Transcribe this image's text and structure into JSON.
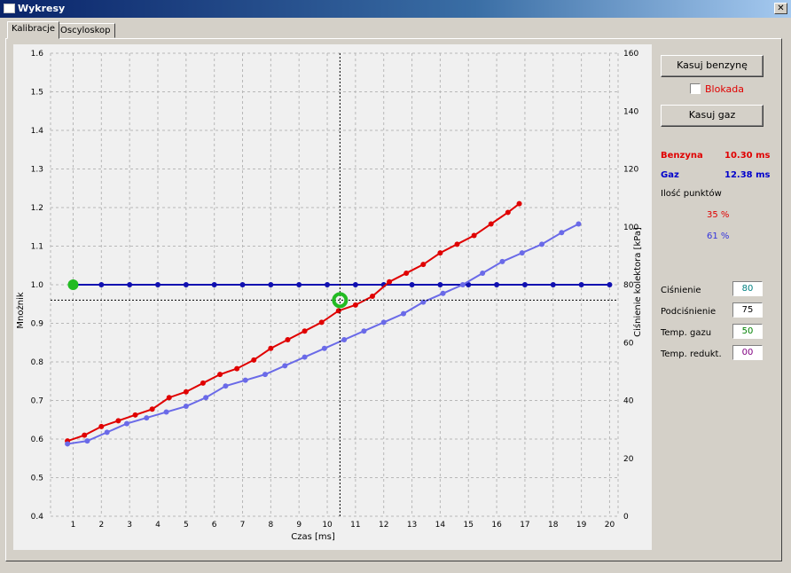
{
  "window": {
    "title": "Wykresy",
    "close_glyph": "✕"
  },
  "tabs": [
    {
      "label": "Kalibracje",
      "active": true
    },
    {
      "label": "Oscyloskop",
      "active": false
    }
  ],
  "side": {
    "kasuj_benzyne": "Kasuj benzynę",
    "blokada": "Blokada",
    "blokada_checked": false,
    "kasuj_gaz": "Kasuj gaz",
    "benzyna_label": "Benzyna",
    "benzyna_value": "10.30 ms",
    "gaz_label": "Gaz",
    "gaz_value": "12.38 ms",
    "ilosc_punktow": "Ilość punktów",
    "pct_benzyna": "35 %",
    "pct_gaz": "61 %",
    "fields": [
      {
        "label": "Ciśnienie",
        "value": "80",
        "color": "#008080"
      },
      {
        "label": "Podciśnienie",
        "value": "75",
        "color": "#000000"
      },
      {
        "label": "Temp. gazu",
        "value": "50",
        "color": "#008000"
      },
      {
        "label": "Temp. redukt.",
        "value": "00",
        "color": "#800080"
      }
    ]
  },
  "colors": {
    "benzyna": "#e00000",
    "gaz": "#0000cc",
    "blue_series": "#6a6ae8",
    "marker": "#22bb22"
  },
  "chart_data": {
    "type": "line",
    "xlabel": "Czas [ms]",
    "ylabel_left": "Mnożnik",
    "ylabel_right": "Ciśnienie kolektora [kPa]",
    "x_ticks": [
      1,
      2,
      3,
      4,
      5,
      6,
      7,
      8,
      9,
      10,
      11,
      12,
      13,
      14,
      15,
      16,
      17,
      18,
      19,
      20
    ],
    "y_left_ticks": [
      "0.4",
      "0.5",
      "0.6",
      "0.7",
      "0.8",
      "0.9",
      "1.0",
      "1.1",
      "1.2",
      "1.3",
      "1.4",
      "1.5",
      "1.6"
    ],
    "y_right_ticks": [
      "0",
      "20",
      "40",
      "60",
      "80",
      "100",
      "120",
      "140",
      "160"
    ],
    "ylim_left": [
      0.4,
      1.6
    ],
    "ylim_right": [
      0,
      160
    ],
    "xlim": [
      0.2,
      20.3
    ],
    "grid": true,
    "cursor": {
      "x": 10.45,
      "y_left": 0.96
    },
    "series": [
      {
        "color": "#1010b0",
        "axis": "left",
        "marker_start": "#22bb22",
        "points": [
          [
            1,
            1.0
          ],
          [
            2,
            1.0
          ],
          [
            3,
            1.0
          ],
          [
            4,
            1.0
          ],
          [
            5,
            1.0
          ],
          [
            6,
            1.0
          ],
          [
            7,
            1.0
          ],
          [
            8,
            1.0
          ],
          [
            9,
            1.0
          ],
          [
            10,
            1.0
          ],
          [
            11,
            1.0
          ],
          [
            12,
            1.0
          ],
          [
            13,
            1.0
          ],
          [
            14,
            1.0
          ],
          [
            15,
            1.0
          ],
          [
            16,
            1.0
          ],
          [
            17,
            1.0
          ],
          [
            18,
            1.0
          ],
          [
            19,
            1.0
          ],
          [
            20,
            1.0
          ]
        ]
      },
      {
        "color": "#e00000",
        "axis": "right",
        "points": [
          [
            0.8,
            26
          ],
          [
            1.4,
            28
          ],
          [
            2,
            31
          ],
          [
            2.6,
            33
          ],
          [
            3.2,
            35
          ],
          [
            3.8,
            37
          ],
          [
            4.4,
            41
          ],
          [
            5,
            43
          ],
          [
            5.6,
            46
          ],
          [
            6.2,
            49
          ],
          [
            6.8,
            51
          ],
          [
            7.4,
            54
          ],
          [
            8,
            58
          ],
          [
            8.6,
            61
          ],
          [
            9.2,
            64
          ],
          [
            9.8,
            67
          ],
          [
            10.4,
            71
          ],
          [
            11,
            73
          ],
          [
            11.6,
            76
          ],
          [
            12.2,
            81
          ],
          [
            12.8,
            84
          ],
          [
            13.4,
            87
          ],
          [
            14,
            91
          ],
          [
            14.6,
            94
          ],
          [
            15.2,
            97
          ],
          [
            15.8,
            101
          ],
          [
            16.4,
            105
          ],
          [
            16.8,
            108
          ]
        ]
      },
      {
        "color": "#6a6ae8",
        "axis": "right",
        "points": [
          [
            0.8,
            25
          ],
          [
            1.5,
            26
          ],
          [
            2.2,
            29
          ],
          [
            2.9,
            32
          ],
          [
            3.6,
            34
          ],
          [
            4.3,
            36
          ],
          [
            5,
            38
          ],
          [
            5.7,
            41
          ],
          [
            6.4,
            45
          ],
          [
            7.1,
            47
          ],
          [
            7.8,
            49
          ],
          [
            8.5,
            52
          ],
          [
            9.2,
            55
          ],
          [
            9.9,
            58
          ],
          [
            10.6,
            61
          ],
          [
            11.3,
            64
          ],
          [
            12,
            67
          ],
          [
            12.7,
            70
          ],
          [
            13.4,
            74
          ],
          [
            14.1,
            77
          ],
          [
            14.8,
            80
          ],
          [
            15.5,
            84
          ],
          [
            16.2,
            88
          ],
          [
            16.9,
            91
          ],
          [
            17.6,
            94
          ],
          [
            18.3,
            98
          ],
          [
            18.9,
            101
          ]
        ]
      }
    ]
  }
}
